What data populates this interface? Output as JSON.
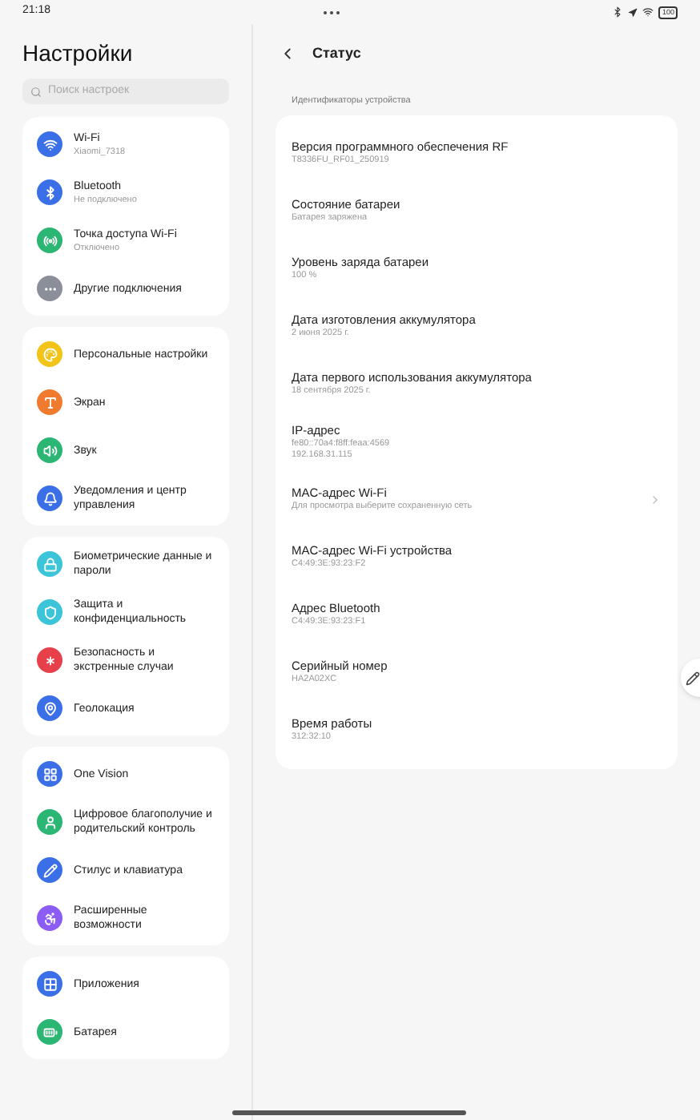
{
  "status_bar": {
    "time": "21:18",
    "battery": "100"
  },
  "sidebar": {
    "title": "Настройки",
    "search": {
      "placeholder": "Поиск настроек"
    },
    "groups": [
      {
        "items": [
          {
            "color": "#3b6fe8",
            "label": "Wi-Fi",
            "sub": "Xiaomi_7318"
          },
          {
            "color": "#3b6fe8",
            "label": "Bluetooth",
            "sub": "Не подключено"
          },
          {
            "color": "#2bb673",
            "label": "Точка доступа Wi-Fi",
            "sub": "Отключено"
          },
          {
            "color": "#8a8f99",
            "label": "Другие подключения"
          }
        ]
      },
      {
        "items": [
          {
            "color": "#f2c417",
            "label": "Персональные настройки"
          },
          {
            "color": "#f07a2e",
            "label": "Экран"
          },
          {
            "color": "#2bb673",
            "label": "Звук"
          },
          {
            "color": "#3b6fe8",
            "label": "Уведомления и центр управления"
          }
        ]
      },
      {
        "items": [
          {
            "color": "#3cc4d8",
            "label": "Биометрические данные и пароли"
          },
          {
            "color": "#3cc4d8",
            "label": "Защита и конфиденциальность"
          },
          {
            "color": "#e8404a",
            "label": "Безопасность и экстренные случаи"
          },
          {
            "color": "#3b6fe8",
            "label": "Геолокация"
          }
        ]
      },
      {
        "items": [
          {
            "color": "#3b6fe8",
            "label": "One Vision"
          },
          {
            "color": "#2bb673",
            "label": "Цифровое благополучие и родительский контроль"
          },
          {
            "color": "#3b6fe8",
            "label": "Стилус и клавиатура"
          },
          {
            "color": "#8b5cf6",
            "label": "Расширенные возможности"
          }
        ]
      },
      {
        "items": [
          {
            "color": "#3b6fe8",
            "label": "Приложения"
          },
          {
            "color": "#2bb673",
            "label": "Батарея"
          }
        ]
      }
    ]
  },
  "detail": {
    "title": "Статус",
    "section": "Идентификаторы устройства",
    "rows": [
      {
        "label": "Версия программного обеспечения RF",
        "values": [
          "T8336FU_RF01_250919"
        ]
      },
      {
        "label": "Состояние батареи",
        "values": [
          "Батарея заряжена"
        ]
      },
      {
        "label": "Уровень заряда батареи",
        "values": [
          "100 %"
        ]
      },
      {
        "label": "Дата изготовления аккумулятора",
        "values": [
          "2 июня 2025 г."
        ]
      },
      {
        "label": "Дата первого использования аккумулятора",
        "values": [
          "18 сентября 2025 г."
        ]
      },
      {
        "label": "IP-адрес",
        "values": [
          "fe80::70a4:f8ff:feaa:4569",
          "192.168.31.115"
        ]
      },
      {
        "label": "MAC-адрес Wi-Fi",
        "values": [
          "Для просмотра выберите сохраненную сеть"
        ],
        "chevron": true
      },
      {
        "label": "MAC-адрес Wi-Fi устройства",
        "values": [
          "C4:49:3E:93:23:F2"
        ]
      },
      {
        "label": "Адрес Bluetooth",
        "values": [
          "C4:49:3E:93:23:F1"
        ]
      },
      {
        "label": "Серийный номер",
        "values": [
          "HA2A02XC"
        ]
      },
      {
        "label": "Время работы",
        "values": [
          "312:32:10"
        ]
      }
    ]
  }
}
